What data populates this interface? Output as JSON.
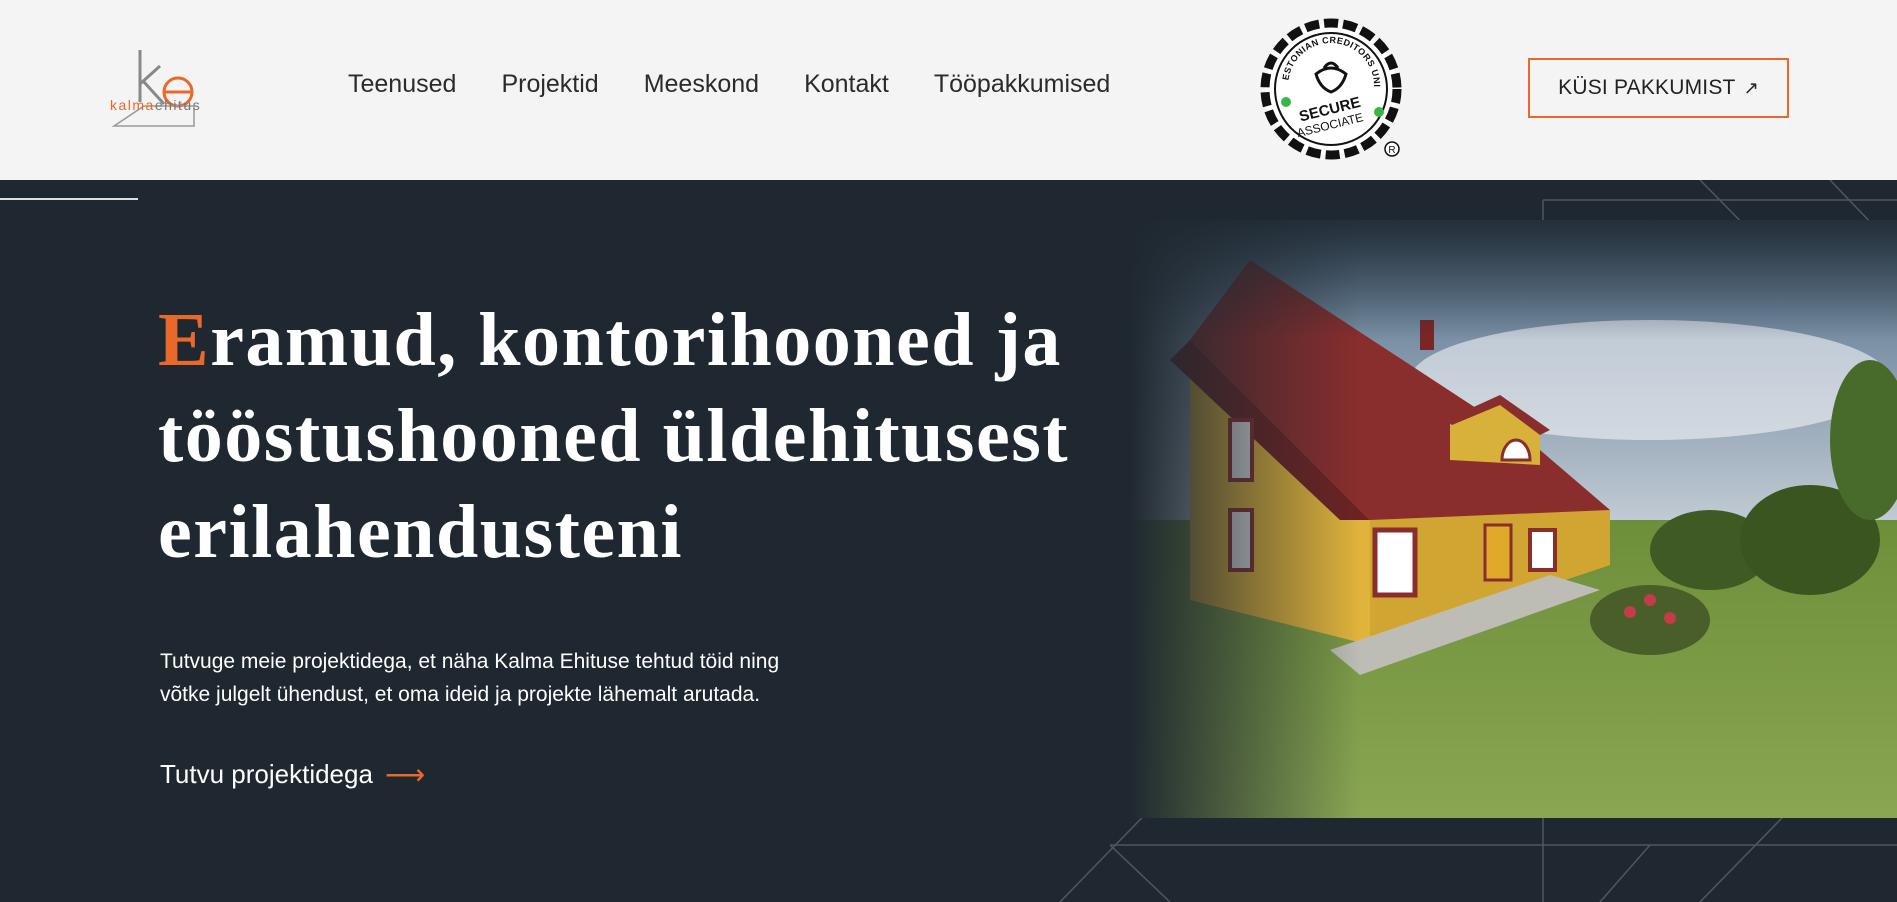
{
  "logo": {
    "mark": "ke",
    "text_a": "kalma",
    "text_b": "ehitus"
  },
  "nav": {
    "items": [
      {
        "label": "Teenused"
      },
      {
        "label": "Projektid"
      },
      {
        "label": "Meeskond"
      },
      {
        "label": "Kontakt"
      },
      {
        "label": "Tööpakkumised"
      }
    ]
  },
  "badge": {
    "ring_text": "ESTONIAN CREDITORS UNION",
    "line1": "SECURE",
    "line2": "ASSOCIATE",
    "registered": "®"
  },
  "cta": {
    "label": "KÜSI PAKKUMIST",
    "icon": "arrow-up-right-icon"
  },
  "hero": {
    "headline_first": "E",
    "headline_rest_1": "ramud, kontorihooned ja",
    "headline_line_2": "tööstushooned üldehitusest",
    "headline_line_3": "erilahendusteni",
    "lead_line_1": "Tutvuge meie projektidega, et näha Kalma Ehituse tehtud töid ning",
    "lead_line_2": "võtke julgelt ühendust, et oma ideid ja projekte lähemalt arutada.",
    "link_label": "Tutvu projektidega",
    "link_icon": "arrow-right-icon"
  },
  "colors": {
    "accent": "#e8692a",
    "hero_bg": "#1f2830",
    "header_bg": "#f4f4f4"
  }
}
